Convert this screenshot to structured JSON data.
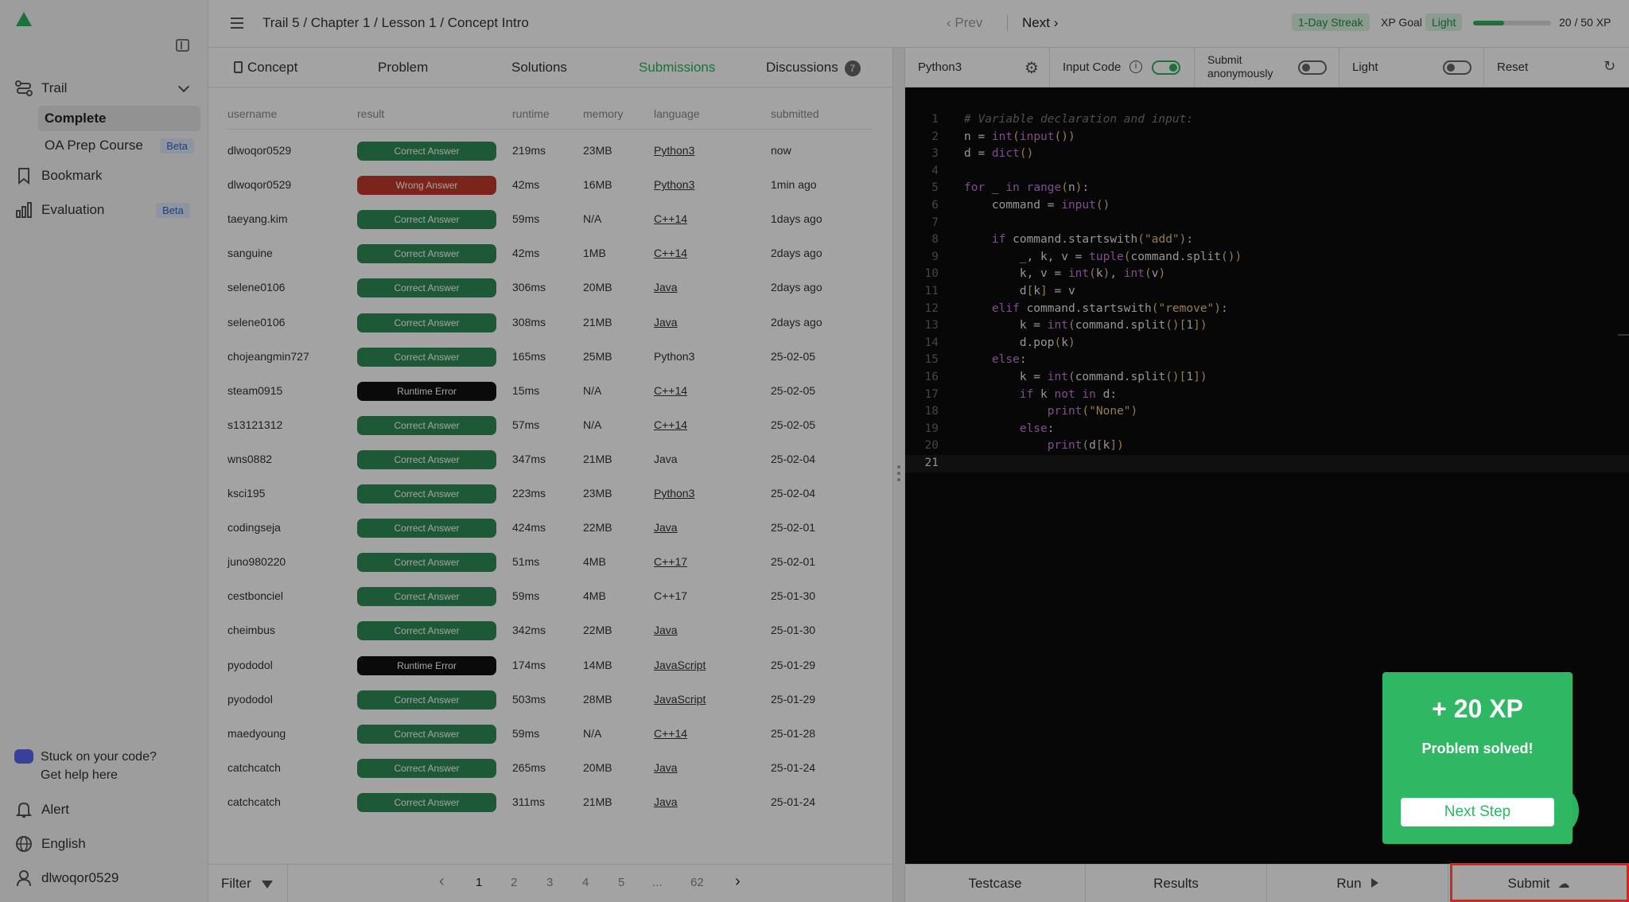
{
  "sidebar": {
    "trail_label": "Trail",
    "complete_label": "Complete",
    "oa_prep_label": "OA Prep Course",
    "beta_label": "Beta",
    "bookmark_label": "Bookmark",
    "evaluation_label": "Evaluation",
    "help_line1": "Stuck on your code?",
    "help_line2": "Get help here",
    "alert_label": "Alert",
    "language_label": "English",
    "user_label": "dlwoqor0529"
  },
  "header": {
    "breadcrumb": "Trail 5 / Chapter 1 / Lesson 1 / Concept Intro",
    "prev_label": "Prev",
    "next_label": "Next",
    "streak_label": "1-Day Streak",
    "xp_goal_label": "XP Goal",
    "xp_mode_label": "Light",
    "xp_progress": 0.4,
    "xp_text": "20 / 50 XP"
  },
  "tabs": {
    "concept": "Concept",
    "problem": "Problem",
    "solutions": "Solutions",
    "submissions": "Submissions",
    "discussions": "Discussions",
    "discussions_count": "7"
  },
  "table": {
    "headers": [
      "username",
      "result",
      "runtime",
      "memory",
      "language",
      "submitted"
    ],
    "rows": [
      {
        "user": "dlwoqor0529",
        "result": "Correct Answer",
        "runtime": "219ms",
        "memory": "23MB",
        "language": "Python3",
        "link": true,
        "submitted": "now"
      },
      {
        "user": "dlwoqor0529",
        "result": "Wrong Answer",
        "runtime": "42ms",
        "memory": "16MB",
        "language": "Python3",
        "link": true,
        "submitted": "1min ago"
      },
      {
        "user": "taeyang.kim",
        "result": "Correct Answer",
        "runtime": "59ms",
        "memory": "N/A",
        "language": "C++14",
        "link": true,
        "submitted": "1days ago"
      },
      {
        "user": "sanguine",
        "result": "Correct Answer",
        "runtime": "42ms",
        "memory": "1MB",
        "language": "C++14",
        "link": true,
        "submitted": "2days ago"
      },
      {
        "user": "selene0106",
        "result": "Correct Answer",
        "runtime": "306ms",
        "memory": "20MB",
        "language": "Java",
        "link": true,
        "submitted": "2days ago"
      },
      {
        "user": "selene0106",
        "result": "Correct Answer",
        "runtime": "308ms",
        "memory": "21MB",
        "language": "Java",
        "link": true,
        "submitted": "2days ago"
      },
      {
        "user": "chojeangmin727",
        "result": "Correct Answer",
        "runtime": "165ms",
        "memory": "25MB",
        "language": "Python3",
        "link": false,
        "submitted": "25-02-05"
      },
      {
        "user": "steam0915",
        "result": "Runtime Error",
        "runtime": "15ms",
        "memory": "N/A",
        "language": "C++14",
        "link": true,
        "submitted": "25-02-05"
      },
      {
        "user": "s13121312",
        "result": "Correct Answer",
        "runtime": "57ms",
        "memory": "N/A",
        "language": "C++14",
        "link": true,
        "submitted": "25-02-05"
      },
      {
        "user": "wns0882",
        "result": "Correct Answer",
        "runtime": "347ms",
        "memory": "21MB",
        "language": "Java",
        "link": false,
        "submitted": "25-02-04"
      },
      {
        "user": "ksci195",
        "result": "Correct Answer",
        "runtime": "223ms",
        "memory": "23MB",
        "language": "Python3",
        "link": true,
        "submitted": "25-02-04"
      },
      {
        "user": "codingseja",
        "result": "Correct Answer",
        "runtime": "424ms",
        "memory": "22MB",
        "language": "Java",
        "link": true,
        "submitted": "25-02-01"
      },
      {
        "user": "juno980220",
        "result": "Correct Answer",
        "runtime": "51ms",
        "memory": "4MB",
        "language": "C++17",
        "link": true,
        "submitted": "25-02-01"
      },
      {
        "user": "cestbonciel",
        "result": "Correct Answer",
        "runtime": "59ms",
        "memory": "4MB",
        "language": "C++17",
        "link": false,
        "submitted": "25-01-30"
      },
      {
        "user": "cheimbus",
        "result": "Correct Answer",
        "runtime": "342ms",
        "memory": "22MB",
        "language": "Java",
        "link": true,
        "submitted": "25-01-30"
      },
      {
        "user": "pyododol",
        "result": "Runtime Error",
        "runtime": "174ms",
        "memory": "14MB",
        "language": "JavaScript",
        "link": true,
        "submitted": "25-01-29"
      },
      {
        "user": "pyododol",
        "result": "Correct Answer",
        "runtime": "503ms",
        "memory": "28MB",
        "language": "JavaScript",
        "link": true,
        "submitted": "25-01-29"
      },
      {
        "user": "maedyoung",
        "result": "Correct Answer",
        "runtime": "59ms",
        "memory": "N/A",
        "language": "C++14",
        "link": true,
        "submitted": "25-01-28"
      },
      {
        "user": "catchcatch",
        "result": "Correct Answer",
        "runtime": "265ms",
        "memory": "20MB",
        "language": "Java",
        "link": true,
        "submitted": "25-01-24"
      },
      {
        "user": "catchcatch",
        "result": "Correct Answer",
        "runtime": "311ms",
        "memory": "21MB",
        "language": "Java",
        "link": true,
        "submitted": "25-01-24"
      }
    ]
  },
  "result_colors": {
    "Correct Answer": "#2e8b57",
    "Wrong Answer": "#c0392b",
    "Runtime Error": "#111111"
  },
  "pagination": {
    "filter_label": "Filter",
    "pages": [
      "1",
      "2",
      "3",
      "4",
      "5",
      "...",
      "62"
    ],
    "current": "1"
  },
  "editor_toolbar": {
    "language": "Python3",
    "input_code_label": "Input Code",
    "input_code_on": true,
    "submit_anon_line1": "Submit",
    "submit_anon_line2": "anonymously",
    "submit_anon_on": false,
    "theme_label": "Light",
    "theme_on": false,
    "reset_label": "Reset"
  },
  "code": {
    "current_line": 21,
    "lines": [
      [
        [
          "cm",
          "# Variable declaration and input:"
        ]
      ],
      [
        [
          "",
          "n = "
        ],
        [
          "fn",
          "int"
        ],
        [
          "pn",
          "("
        ],
        [
          "fn",
          "input"
        ],
        [
          "pn",
          "())"
        ]
      ],
      [
        [
          "",
          "d = "
        ],
        [
          "fn",
          "dict"
        ],
        [
          "pn",
          "()"
        ]
      ],
      [],
      [
        [
          "kw",
          "for"
        ],
        [
          "",
          " _ "
        ],
        [
          "kw",
          "in"
        ],
        [
          "",
          " "
        ],
        [
          "fn",
          "range"
        ],
        [
          "pn",
          "("
        ],
        [
          "",
          "n"
        ],
        [
          "pn",
          ")"
        ],
        [
          "",
          ":"
        ]
      ],
      [
        [
          "",
          "    command = "
        ],
        [
          "fn",
          "input"
        ],
        [
          "pn",
          "()"
        ]
      ],
      [],
      [
        [
          "",
          "    "
        ],
        [
          "kw",
          "if"
        ],
        [
          "",
          " command.startswith"
        ],
        [
          "pn",
          "("
        ],
        [
          "str",
          "\"add\""
        ],
        [
          "pn",
          ")"
        ],
        [
          "",
          ":"
        ]
      ],
      [
        [
          "",
          "        _, k, v = "
        ],
        [
          "fn",
          "tuple"
        ],
        [
          "pn",
          "("
        ],
        [
          "",
          "command.split"
        ],
        [
          "pn",
          "())"
        ]
      ],
      [
        [
          "",
          "        k, v = "
        ],
        [
          "fn",
          "int"
        ],
        [
          "pn",
          "("
        ],
        [
          "",
          "k"
        ],
        [
          "pn",
          ")"
        ],
        [
          "",
          ", "
        ],
        [
          "fn",
          "int"
        ],
        [
          "pn",
          "("
        ],
        [
          "",
          "v"
        ],
        [
          "pn",
          ")"
        ]
      ],
      [
        [
          "",
          "        d"
        ],
        [
          "pn",
          "["
        ],
        [
          "",
          "k"
        ],
        [
          "pn",
          "]"
        ],
        [
          "",
          " = v"
        ]
      ],
      [
        [
          "",
          "    "
        ],
        [
          "kw",
          "elif"
        ],
        [
          "",
          " command.startswith"
        ],
        [
          "pn",
          "("
        ],
        [
          "str",
          "\"remove\""
        ],
        [
          "pn",
          ")"
        ],
        [
          "",
          ":"
        ]
      ],
      [
        [
          "",
          "        k = "
        ],
        [
          "fn",
          "int"
        ],
        [
          "pn",
          "("
        ],
        [
          "",
          "command.split"
        ],
        [
          "pn",
          "()["
        ],
        [
          "",
          "1"
        ],
        [
          "pn",
          "])"
        ]
      ],
      [
        [
          "",
          "        d.pop"
        ],
        [
          "pn",
          "("
        ],
        [
          "",
          "k"
        ],
        [
          "pn",
          ")"
        ]
      ],
      [
        [
          "",
          "    "
        ],
        [
          "kw",
          "else"
        ],
        [
          "",
          ":"
        ]
      ],
      [
        [
          "",
          "        k = "
        ],
        [
          "fn",
          "int"
        ],
        [
          "pn",
          "("
        ],
        [
          "",
          "command.split"
        ],
        [
          "pn",
          "()["
        ],
        [
          "",
          "1"
        ],
        [
          "pn",
          "])"
        ]
      ],
      [
        [
          "",
          "        "
        ],
        [
          "kw",
          "if"
        ],
        [
          "",
          " k "
        ],
        [
          "kw",
          "not in"
        ],
        [
          "",
          " d:"
        ]
      ],
      [
        [
          "",
          "            "
        ],
        [
          "fn",
          "print"
        ],
        [
          "pn",
          "("
        ],
        [
          "str",
          "\"None\""
        ],
        [
          "pn",
          ")"
        ]
      ],
      [
        [
          "",
          "        "
        ],
        [
          "kw",
          "else"
        ],
        [
          "",
          ":"
        ]
      ],
      [
        [
          "",
          "            "
        ],
        [
          "fn",
          "print"
        ],
        [
          "pn",
          "("
        ],
        [
          "",
          "d"
        ],
        [
          "pn",
          "["
        ],
        [
          "",
          "k"
        ],
        [
          "pn",
          "])"
        ]
      ],
      []
    ]
  },
  "editor_footer": {
    "testcase_label": "Testcase",
    "results_label": "Results",
    "run_label": "Run",
    "submit_label": "Submit"
  },
  "popup": {
    "xp_text": "+ 20 XP",
    "message": "Problem solved!",
    "next_step_label": "Next Step"
  }
}
